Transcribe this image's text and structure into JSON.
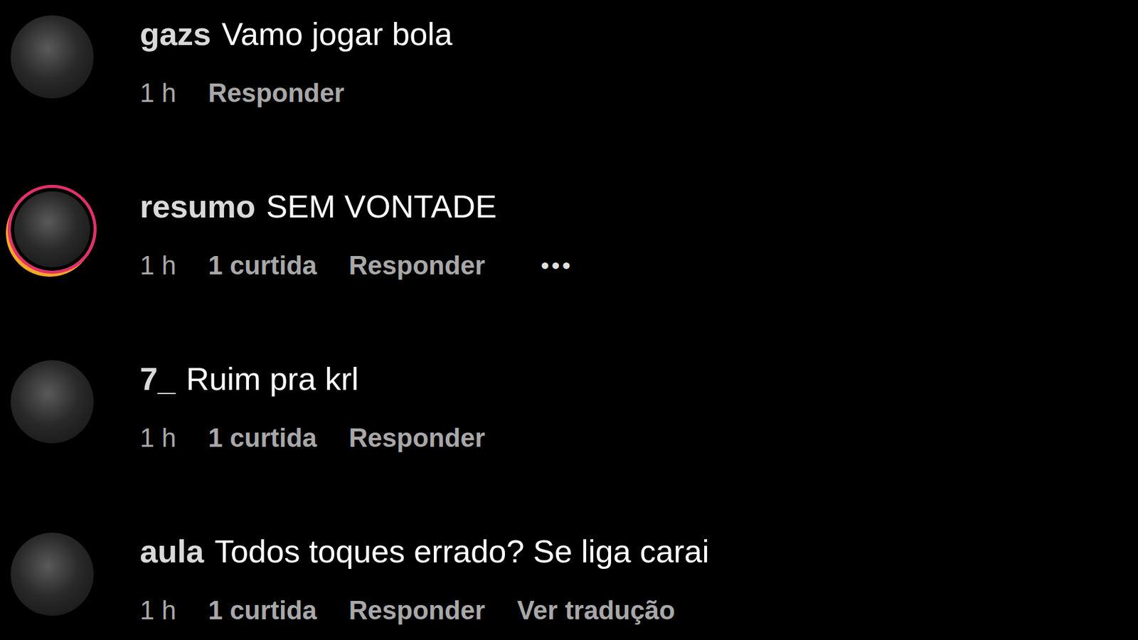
{
  "comments": [
    {
      "username": "gazs",
      "text": "Vamo jogar bola",
      "time": "1 h",
      "likes": "",
      "reply": "Responder",
      "more": "",
      "translate": "",
      "story_ring": false
    },
    {
      "username": "resumo",
      "text": "SEM VONTADE",
      "time": "1 h",
      "likes": "1 curtida",
      "reply": "Responder",
      "more": "•••",
      "translate": "",
      "story_ring": true
    },
    {
      "username": "7_",
      "text": "Ruim pra krl",
      "time": "1 h",
      "likes": "1 curtida",
      "reply": "Responder",
      "more": "",
      "translate": "",
      "story_ring": false
    },
    {
      "username": "aula",
      "text": "Todos toques errado? Se liga carai",
      "time": "1 h",
      "likes": "1 curtida",
      "reply": "Responder",
      "more": "",
      "translate": "Ver tradução",
      "story_ring": false
    }
  ]
}
